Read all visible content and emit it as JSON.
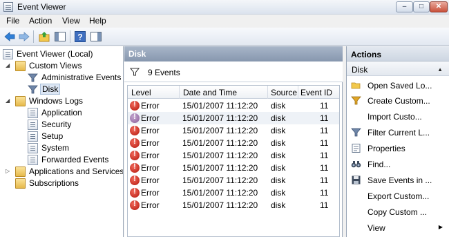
{
  "window": {
    "title": "Event Viewer"
  },
  "menu": [
    "File",
    "Action",
    "View",
    "Help"
  ],
  "tree": {
    "root": "Event Viewer (Local)",
    "custom_views": "Custom Views",
    "administrative_events": "Administrative Events",
    "disk": "Disk",
    "windows_logs": "Windows Logs",
    "application": "Application",
    "security": "Security",
    "setup": "Setup",
    "system": "System",
    "forwarded_events": "Forwarded Events",
    "apps_services": "Applications and Services",
    "subscriptions": "Subscriptions"
  },
  "middle": {
    "header": "Disk",
    "event_count": "9 Events",
    "columns": {
      "level": "Level",
      "datetime": "Date and Time",
      "source": "Source",
      "event_id": "Event ID"
    },
    "rows": [
      {
        "level": "Error",
        "datetime": "15/01/2007 11:12:20",
        "source": "disk",
        "event_id": "11"
      },
      {
        "level": "Error",
        "datetime": "15/01/2007 11:12:20",
        "source": "disk",
        "event_id": "11"
      },
      {
        "level": "Error",
        "datetime": "15/01/2007 11:12:20",
        "source": "disk",
        "event_id": "11"
      },
      {
        "level": "Error",
        "datetime": "15/01/2007 11:12:20",
        "source": "disk",
        "event_id": "11"
      },
      {
        "level": "Error",
        "datetime": "15/01/2007 11:12:20",
        "source": "disk",
        "event_id": "11"
      },
      {
        "level": "Error",
        "datetime": "15/01/2007 11:12:20",
        "source": "disk",
        "event_id": "11"
      },
      {
        "level": "Error",
        "datetime": "15/01/2007 11:12:20",
        "source": "disk",
        "event_id": "11"
      },
      {
        "level": "Error",
        "datetime": "15/01/2007 11:12:20",
        "source": "disk",
        "event_id": "11"
      },
      {
        "level": "Error",
        "datetime": "15/01/2007 11:12:20",
        "source": "disk",
        "event_id": "11"
      }
    ]
  },
  "actions": {
    "header": "Actions",
    "group": "Disk",
    "items": [
      "Open Saved Lo...",
      "Create Custom...",
      "Import Custo...",
      "Filter Current L...",
      "Properties",
      "Find...",
      "Save Events in ...",
      "Export Custom...",
      "Copy Custom ...",
      "View"
    ]
  }
}
